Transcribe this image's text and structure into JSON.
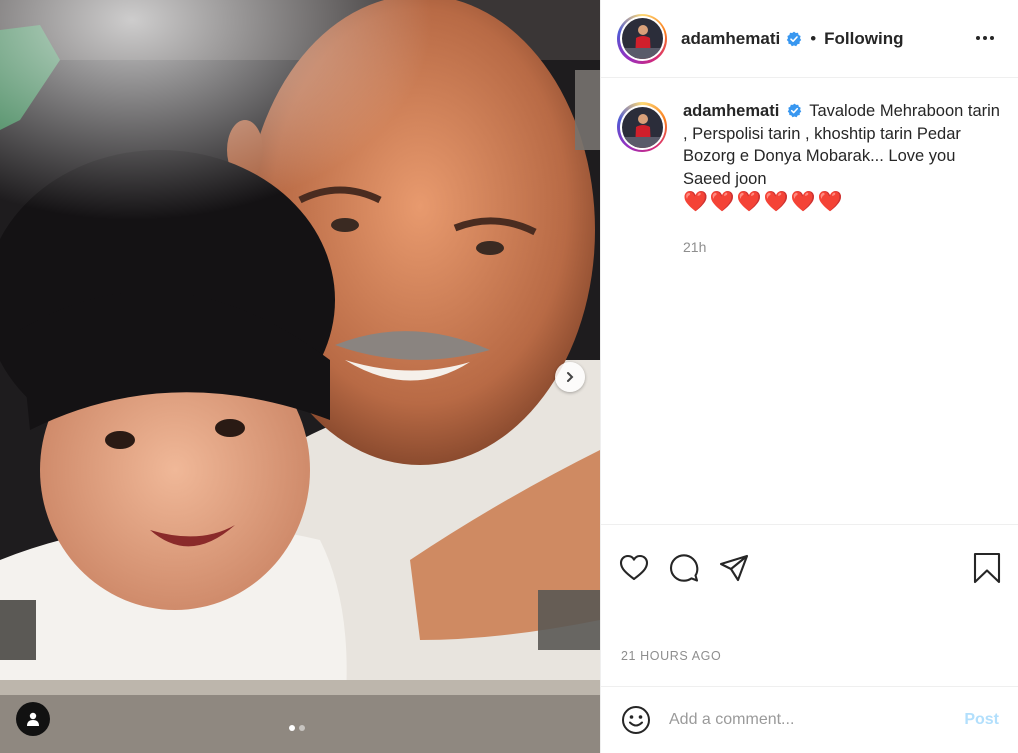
{
  "post": {
    "username": "adamhemati",
    "separator": "•",
    "follow_status": "Following",
    "caption_user": "adamhemati",
    "caption_text": "Tavalode Mehraboon tarin , Perspolisi tarin , khoshtip tarin Pedar Bozorg e Donya Mobarak... Love you Saeed joon",
    "caption_emoji": "❤️❤️❤️❤️❤️❤️",
    "caption_age": "21h",
    "timestamp": "21 HOURS AGO"
  },
  "comment": {
    "placeholder": "Add a comment...",
    "post_label": "Post"
  },
  "carousel": {
    "total_slides": 2,
    "current_slide": 1
  },
  "icons": {
    "verified": "verified-badge-icon",
    "more": "more-options-icon",
    "like": "heart-icon",
    "comment": "comment-icon",
    "share": "share-icon",
    "save": "bookmark-icon",
    "emoji": "emoji-icon",
    "tag": "user-tag-icon",
    "next": "chevron-right-icon"
  },
  "colors": {
    "verified_blue": "#3897f0",
    "post_button_disabled": "#b2dffc",
    "heart_red": "#e0245e"
  }
}
